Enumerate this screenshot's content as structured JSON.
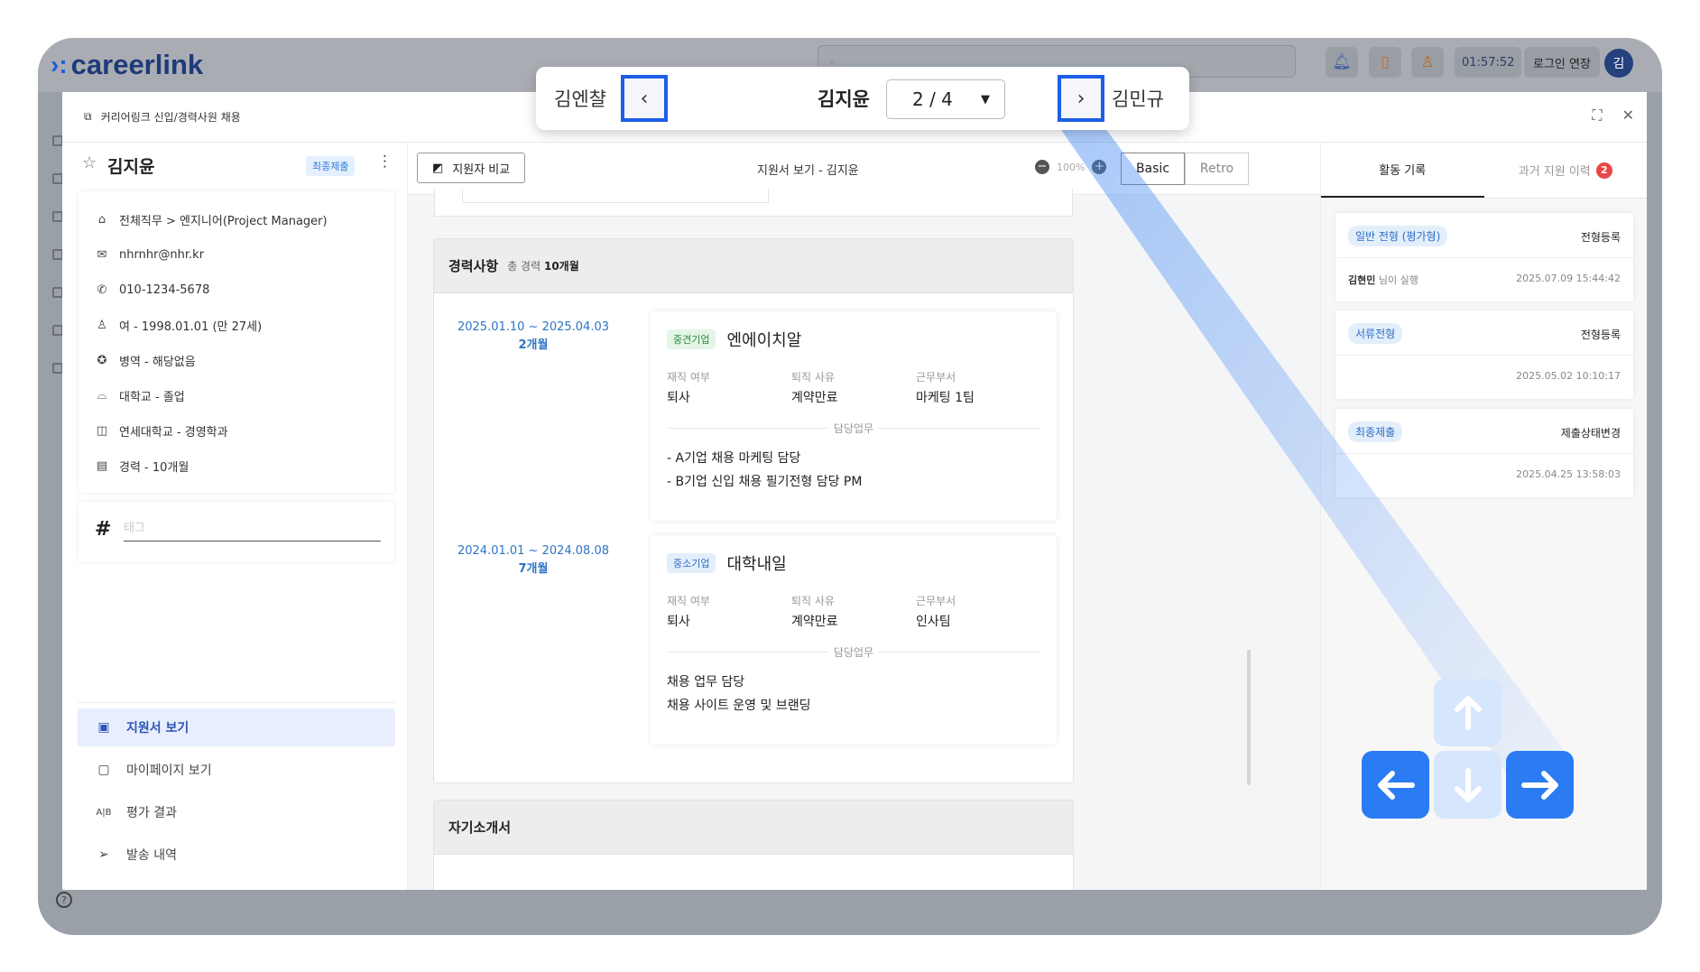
{
  "header": {
    "brand": "careerlink",
    "timer": "01:57:52",
    "login_extend": "로그인 연장",
    "avatar": "김"
  },
  "modal": {
    "title": "커리어링크 신입/경력사원 채용"
  },
  "candidate": {
    "name": "김지윤",
    "badge": "최종제출",
    "info": [
      {
        "icon": "tag-icon",
        "text": "전체직무 > 엔지니어(Project Manager)"
      },
      {
        "icon": "mail-icon",
        "text": "nhrnhr@nhr.kr"
      },
      {
        "icon": "phone-icon",
        "text": "010-1234-5678"
      },
      {
        "icon": "person-icon",
        "text": "여 - 1998.01.01 (만 27세)"
      },
      {
        "icon": "medal-icon",
        "text": "병역 - 해당없음"
      },
      {
        "icon": "graduation-cap-icon",
        "text": "대학교 - 졸업"
      },
      {
        "icon": "book-icon",
        "text": "연세대학교 - 경영학과"
      },
      {
        "icon": "briefcase-icon",
        "text": "경력 - 10개월"
      }
    ],
    "tag_placeholder": "태그"
  },
  "left_nav": [
    {
      "label": "지원서 보기",
      "icon": "resume-search-icon",
      "active": true
    },
    {
      "label": "마이페이지 보기",
      "icon": "clipboard-icon",
      "active": false
    },
    {
      "label": "평가 결과",
      "icon": "ab-test-icon",
      "active": false
    },
    {
      "label": "발송 내역",
      "icon": "send-icon",
      "active": false
    }
  ],
  "toolbar": {
    "compare": "지원자 비교",
    "title": "지원서 보기 - 김지윤",
    "zoom": "100%",
    "view_basic": "Basic",
    "view_retro": "Retro"
  },
  "career": {
    "title": "경력사항",
    "total_prefix": "총 경력",
    "total": "10개월",
    "label_status": "재직 여부",
    "label_reason": "퇴직 사유",
    "label_dept": "근무부서",
    "label_duty": "담당업무",
    "jobs": [
      {
        "period": "2025.01.10 ~ 2025.04.03",
        "duration": "2개월",
        "type": "중견기업",
        "company": "엔에이치알",
        "status": "퇴사",
        "reason": "계약만료",
        "dept": "마케팅 1팀",
        "duties": [
          "- A기업 채용 마케팅 담당",
          "- B기업 신입 채용 필기전형 담당 PM"
        ]
      },
      {
        "period": "2024.01.01 ~ 2024.08.08",
        "duration": "7개월",
        "type": "중소기업",
        "company": "대학내일",
        "status": "퇴사",
        "reason": "계약만료",
        "dept": "인사팀",
        "duties": [
          "채용 업무 담당",
          "채용 사이트 운영 및 브랜딩"
        ]
      }
    ]
  },
  "intro": {
    "title": "자기소개서"
  },
  "right_panel": {
    "tab_activity": "활동 기록",
    "tab_history": "과거 지원 이력",
    "history_count": "2",
    "activities": [
      {
        "badge": "일반 전형 (평가형)",
        "title": "전형등록",
        "by_name": "김현민",
        "by_suffix": "님이 실행",
        "time": "2025.07.09 15:44:42"
      },
      {
        "badge": "서류전형",
        "title": "전형등록",
        "by_name": "",
        "by_suffix": "",
        "time": "2025.05.02 10:10:17"
      },
      {
        "badge": "최종제출",
        "title": "제출상태변경",
        "by_name": "",
        "by_suffix": "",
        "time": "2025.04.25 13:58:03"
      }
    ]
  },
  "navigator": {
    "prev_name": "김엔챨",
    "current_name": "김지윤",
    "position": "2 / 4",
    "next_name": "김민규"
  },
  "colors": {
    "accent": "#1d5ee6",
    "arrow_active": "#2b7bf2",
    "arrow_inactive": "#d6e6fd",
    "badge_red": "#e94646"
  }
}
